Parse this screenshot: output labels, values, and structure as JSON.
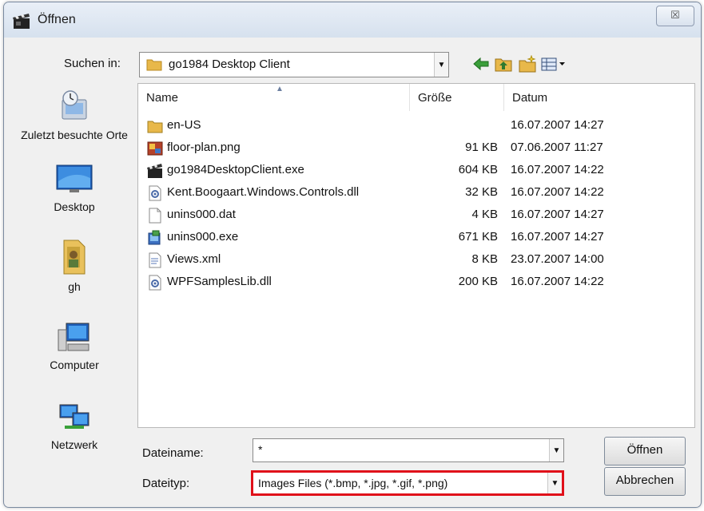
{
  "window": {
    "title": "Öffnen",
    "close_glyph": "☒"
  },
  "lookin": {
    "label": "Suchen in:",
    "value": "go1984 Desktop Client",
    "arrow": "▼"
  },
  "toolbar": {
    "icons": [
      "back-icon",
      "up-folder-icon",
      "new-folder-icon",
      "view-menu-icon"
    ]
  },
  "places": [
    {
      "label": "Zuletzt besuchte Orte",
      "icon": "recent-places-icon"
    },
    {
      "label": "Desktop",
      "icon": "desktop-icon"
    },
    {
      "label": "gh",
      "icon": "user-folder-icon"
    },
    {
      "label": "Computer",
      "icon": "computer-icon"
    },
    {
      "label": "Netzwerk",
      "icon": "network-icon"
    }
  ],
  "columns": {
    "name": "Name",
    "size": "Größe",
    "date": "Datum",
    "sort_glyph": "▲"
  },
  "files": [
    {
      "name": "en-US",
      "size": "",
      "date": "16.07.2007 14:27",
      "icon": "folder-icon"
    },
    {
      "name": "floor-plan.png",
      "size": "91 KB",
      "date": "07.06.2007 11:27",
      "icon": "image-file-icon"
    },
    {
      "name": "go1984DesktopClient.exe",
      "size": "604 KB",
      "date": "16.07.2007 14:22",
      "icon": "clapperboard-exe-icon"
    },
    {
      "name": "Kent.Boogaart.Windows.Controls.dll",
      "size": "32 KB",
      "date": "16.07.2007 14:22",
      "icon": "dll-file-icon"
    },
    {
      "name": "unins000.dat",
      "size": "4 KB",
      "date": "16.07.2007 14:27",
      "icon": "blank-file-icon"
    },
    {
      "name": "unins000.exe",
      "size": "671 KB",
      "date": "16.07.2007 14:27",
      "icon": "installer-exe-icon"
    },
    {
      "name": "Views.xml",
      "size": "8 KB",
      "date": "23.07.2007 14:00",
      "icon": "xml-file-icon"
    },
    {
      "name": "WPFSamplesLib.dll",
      "size": "200 KB",
      "date": "16.07.2007 14:22",
      "icon": "dll-file-icon"
    }
  ],
  "filename": {
    "label": "Dateiname:",
    "value": "*"
  },
  "filetype": {
    "label": "Dateityp:",
    "value": "Images Files (*.bmp, *.jpg, *.gif, *.png)"
  },
  "buttons": {
    "open": "Öffnen",
    "cancel": "Abbrechen"
  },
  "colors": {
    "highlight": "#e0101a",
    "folder": "#e8b84a"
  }
}
